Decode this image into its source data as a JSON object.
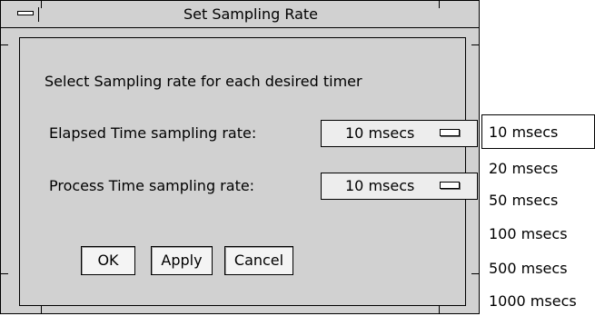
{
  "window": {
    "title": "Set Sampling Rate"
  },
  "instruction": "Select Sampling rate for each desired timer",
  "elapsed": {
    "label": "Elapsed Time sampling rate:",
    "value": "10 msecs"
  },
  "process": {
    "label": "Process Time sampling rate:",
    "value": "10 msecs"
  },
  "buttons": {
    "ok": "OK",
    "apply": "Apply",
    "cancel": "Cancel"
  },
  "dropdown": {
    "selected_index": 0,
    "options": [
      "10 msecs",
      "20 msecs",
      "50 msecs",
      "100 msecs",
      "500 msecs",
      "1000 msecs"
    ]
  },
  "colors": {
    "background": "#d9d9d9",
    "frame": "#000000"
  }
}
